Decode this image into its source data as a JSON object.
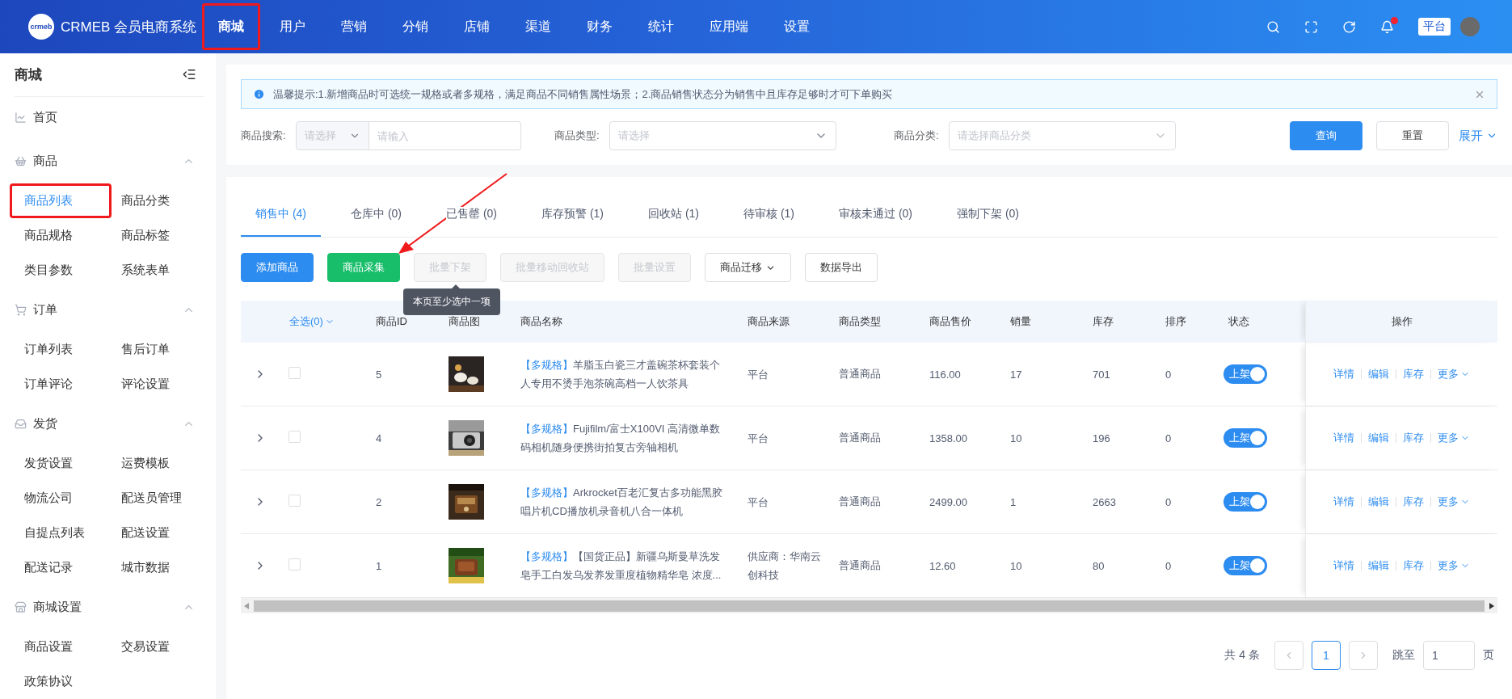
{
  "header": {
    "logo_mark": "crmeb",
    "brand": "CRMEB 会员电商系统",
    "nav": [
      {
        "label": "商城",
        "selected": true,
        "highlighted": true
      },
      {
        "label": "用户",
        "selected": false,
        "highlighted": false
      },
      {
        "label": "营销",
        "selected": false,
        "highlighted": false
      },
      {
        "label": "分销",
        "selected": false,
        "highlighted": false
      },
      {
        "label": "店铺",
        "selected": false,
        "highlighted": false
      },
      {
        "label": "渠道",
        "selected": false,
        "highlighted": false
      },
      {
        "label": "财务",
        "selected": false,
        "highlighted": false
      },
      {
        "label": "统计",
        "selected": false,
        "highlighted": false
      },
      {
        "label": "应用端",
        "selected": false,
        "highlighted": false
      },
      {
        "label": "设置",
        "selected": false,
        "highlighted": false
      }
    ],
    "notification_dot": true,
    "platform_badge": "平台"
  },
  "sidebar": {
    "title": "商城",
    "home": {
      "label": "首页"
    },
    "groups": [
      {
        "label": "商品",
        "expanded": true,
        "items": [
          {
            "label": "商品列表",
            "selected": true,
            "highlighted": true
          },
          {
            "label": "商品分类",
            "selected": false,
            "highlighted": false
          },
          {
            "label": "商品规格",
            "selected": false,
            "highlighted": false
          },
          {
            "label": "商品标签",
            "selected": false,
            "highlighted": false
          },
          {
            "label": "类目参数",
            "selected": false,
            "highlighted": false
          },
          {
            "label": "系统表单",
            "selected": false,
            "highlighted": false
          }
        ]
      },
      {
        "label": "订单",
        "expanded": true,
        "items": [
          {
            "label": "订单列表",
            "selected": false,
            "highlighted": false
          },
          {
            "label": "售后订单",
            "selected": false,
            "highlighted": false
          },
          {
            "label": "订单评论",
            "selected": false,
            "highlighted": false
          },
          {
            "label": "评论设置",
            "selected": false,
            "highlighted": false
          }
        ]
      },
      {
        "label": "发货",
        "expanded": true,
        "items": [
          {
            "label": "发货设置",
            "selected": false,
            "highlighted": false
          },
          {
            "label": "运费模板",
            "selected": false,
            "highlighted": false
          },
          {
            "label": "物流公司",
            "selected": false,
            "highlighted": false
          },
          {
            "label": "配送员管理",
            "selected": false,
            "highlighted": false
          },
          {
            "label": "自提点列表",
            "selected": false,
            "highlighted": false
          },
          {
            "label": "配送设置",
            "selected": false,
            "highlighted": false
          },
          {
            "label": "配送记录",
            "selected": false,
            "highlighted": false
          },
          {
            "label": "城市数据",
            "selected": false,
            "highlighted": false
          }
        ]
      },
      {
        "label": "商城设置",
        "expanded": true,
        "items": [
          {
            "label": "商品设置",
            "selected": false,
            "highlighted": false
          },
          {
            "label": "交易设置",
            "selected": false,
            "highlighted": false
          },
          {
            "label": "政策协议",
            "selected": false,
            "highlighted": false
          }
        ]
      }
    ]
  },
  "notice": {
    "text": "温馨提示:1.新增商品时可选统一规格或者多规格，满足商品不同销售属性场景；2.商品销售状态分为销售中且库存足够时才可下单购买"
  },
  "filters": {
    "search": {
      "label": "商品搜索:",
      "select_placeholder": "请选择",
      "placeholder": "请输入"
    },
    "type": {
      "label": "商品类型:",
      "placeholder": "请选择"
    },
    "category": {
      "label": "商品分类:",
      "placeholder": "请选择商品分类"
    },
    "query_button": "查询",
    "reset_button": "重置",
    "expand_link": "展开"
  },
  "tabs": [
    {
      "label": "销售中 (4)",
      "selected": true
    },
    {
      "label": "仓库中 (0)",
      "selected": false
    },
    {
      "label": "已售罄 (0)",
      "selected": false
    },
    {
      "label": "库存预警 (1)",
      "selected": false
    },
    {
      "label": "回收站 (1)",
      "selected": false
    },
    {
      "label": "待审核 (1)",
      "selected": false
    },
    {
      "label": "审核未通过 (0)",
      "selected": false
    },
    {
      "label": "强制下架 (0)",
      "selected": false
    }
  ],
  "toolbar": [
    {
      "label": "添加商品",
      "kind": "primary",
      "disabled": false,
      "dropdown": false
    },
    {
      "label": "商品采集",
      "kind": "success",
      "disabled": false,
      "dropdown": false
    },
    {
      "label": "批量下架",
      "kind": "default",
      "disabled": true,
      "dropdown": false
    },
    {
      "label": "批量移动回收站",
      "kind": "default",
      "disabled": true,
      "dropdown": false
    },
    {
      "label": "批量设置",
      "kind": "default",
      "disabled": true,
      "dropdown": false
    },
    {
      "label": "商品迁移",
      "kind": "default",
      "disabled": false,
      "dropdown": true
    },
    {
      "label": "数据导出",
      "kind": "default",
      "disabled": false,
      "dropdown": false
    }
  ],
  "tooltip": "本页至少选中一项",
  "table": {
    "select_all": "全选(0)",
    "columns": [
      "商品ID",
      "商品图",
      "商品名称",
      "商品来源",
      "商品类型",
      "商品售价",
      "销量",
      "库存",
      "排序",
      "状态",
      "操作"
    ],
    "rows": [
      {
        "id": "5",
        "tag": "【多规格】",
        "name": "羊脂玉白瓷三才盖碗茶杯套装个人专用不烫手泡茶碗高档一人饮茶具",
        "source": "平台",
        "type": "普通商品",
        "price": "116.00",
        "sales": "17",
        "stock": "701",
        "sort": "0",
        "checked": false,
        "status": {
          "label": "上架",
          "on": true
        },
        "actions": [
          "详情",
          "编辑",
          "库存",
          "更多"
        ]
      },
      {
        "id": "4",
        "tag": "【多规格】",
        "name": "Fujifilm/富士X100VI 高清微单数码相机随身便携街拍复古旁轴相机",
        "source": "平台",
        "type": "普通商品",
        "price": "1358.00",
        "sales": "10",
        "stock": "196",
        "sort": "0",
        "checked": false,
        "status": {
          "label": "上架",
          "on": true
        },
        "actions": [
          "详情",
          "编辑",
          "库存",
          "更多"
        ]
      },
      {
        "id": "2",
        "tag": "【多规格】",
        "name": "Arkrocket百老汇复古多功能黑胶唱片机CD播放机录音机八合一体机",
        "source": "平台",
        "type": "普通商品",
        "price": "2499.00",
        "sales": "1",
        "stock": "2663",
        "sort": "0",
        "checked": false,
        "status": {
          "label": "上架",
          "on": true
        },
        "actions": [
          "详情",
          "编辑",
          "库存",
          "更多"
        ]
      },
      {
        "id": "1",
        "tag": "【多规格】",
        "name": "【国货正品】新疆乌斯曼草洗发皂手工白发乌发养发重度植物精华皂 浓度...",
        "source": "供应商：华南云创科技",
        "type": "普通商品",
        "price": "12.60",
        "sales": "10",
        "stock": "80",
        "sort": "0",
        "checked": false,
        "status": {
          "label": "上架",
          "on": true
        },
        "actions": [
          "详情",
          "编辑",
          "库存",
          "更多"
        ]
      }
    ]
  },
  "pagination": {
    "total": "共 4 条",
    "pages": [
      {
        "label": "1",
        "selected": true
      }
    ],
    "jump_label": "跳至",
    "jump_value": "1",
    "page_suffix": "页"
  }
}
